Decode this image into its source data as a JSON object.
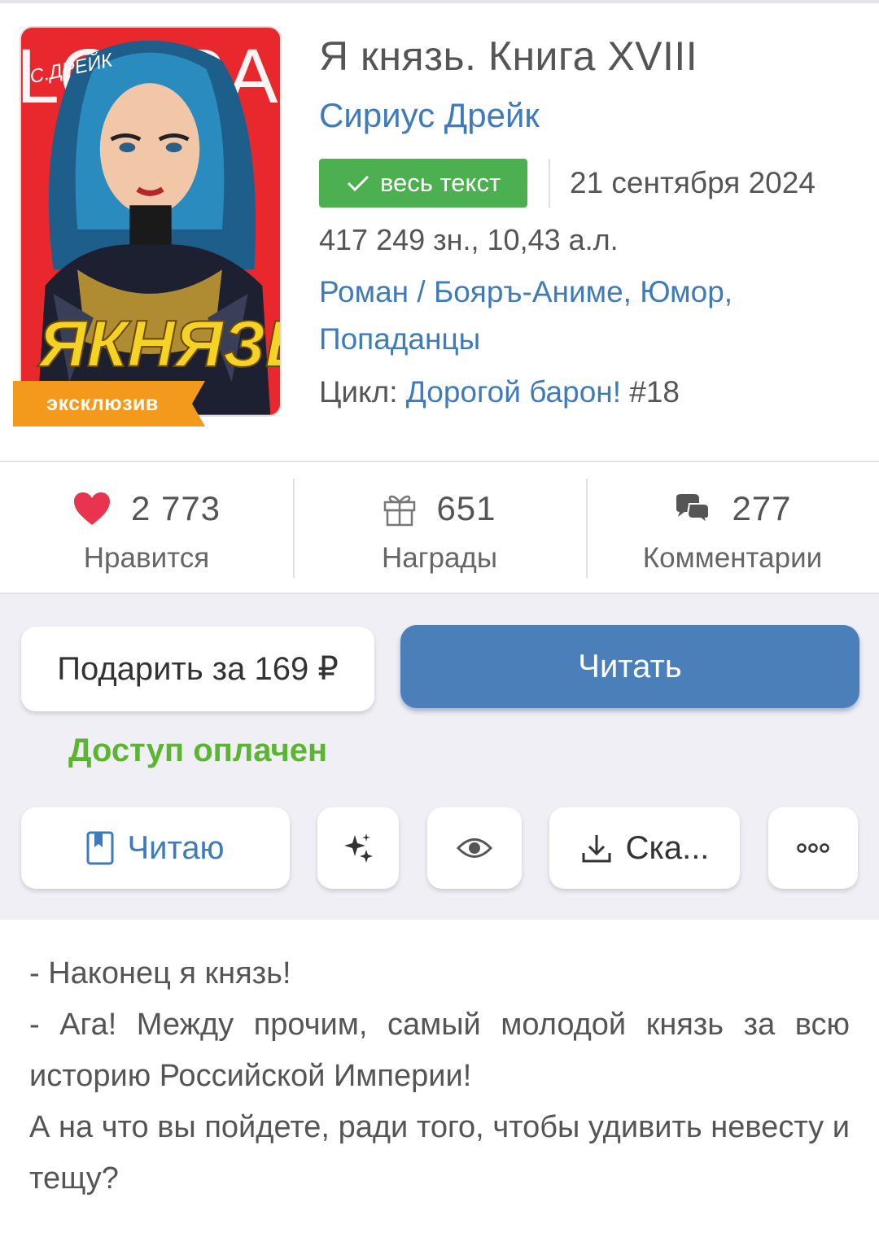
{
  "book": {
    "title": "Я князь. Книга XVIII",
    "author": "Сириус Дрейк",
    "status_label": "весь текст",
    "date": "21 сентября 2024",
    "stats": "417 249 зн., 10,43 а.л.",
    "genre_main": "Роман",
    "genre_sep": " / ",
    "genres": "Бояръ-Аниме, Юмор,",
    "genres_line2": "Попаданцы",
    "series_prefix": "Цикл: ",
    "series_name": "Дорогой барон!",
    "series_number": " #18",
    "exclusive_label": "эксклюзив"
  },
  "cover": {
    "top_text": "LOKRA",
    "author_script": "С.ДРЕЙК",
    "title_script": "ЯКНЯЗЬ"
  },
  "counters": {
    "likes": {
      "value": "2 773",
      "label": "Нравится"
    },
    "awards": {
      "value": "651",
      "label": "Награды"
    },
    "comments": {
      "value": "277",
      "label": "Комментарии"
    }
  },
  "actions": {
    "gift_label": "Подарить за 169 ₽",
    "read_label": "Читать",
    "paid_label": "Доступ оплачен",
    "reading_label": "Читаю",
    "download_label": "Ска..."
  },
  "description": [
    "- Наконец я князь!",
    "- Ага! Между прочим, самый молодой князь за всю историю Российской Империи!",
    "А на что вы пойдете, ради того, чтобы удивить невесту и тещу?"
  ],
  "colors": {
    "accent": "#3e7bbd",
    "read_button": "#4a7fb9",
    "status_green": "#4caf50",
    "paid_green": "#5bb530",
    "exclusive_orange": "#f39a1c",
    "heart_red": "#e8344e",
    "panel_bg": "#efeff5"
  }
}
